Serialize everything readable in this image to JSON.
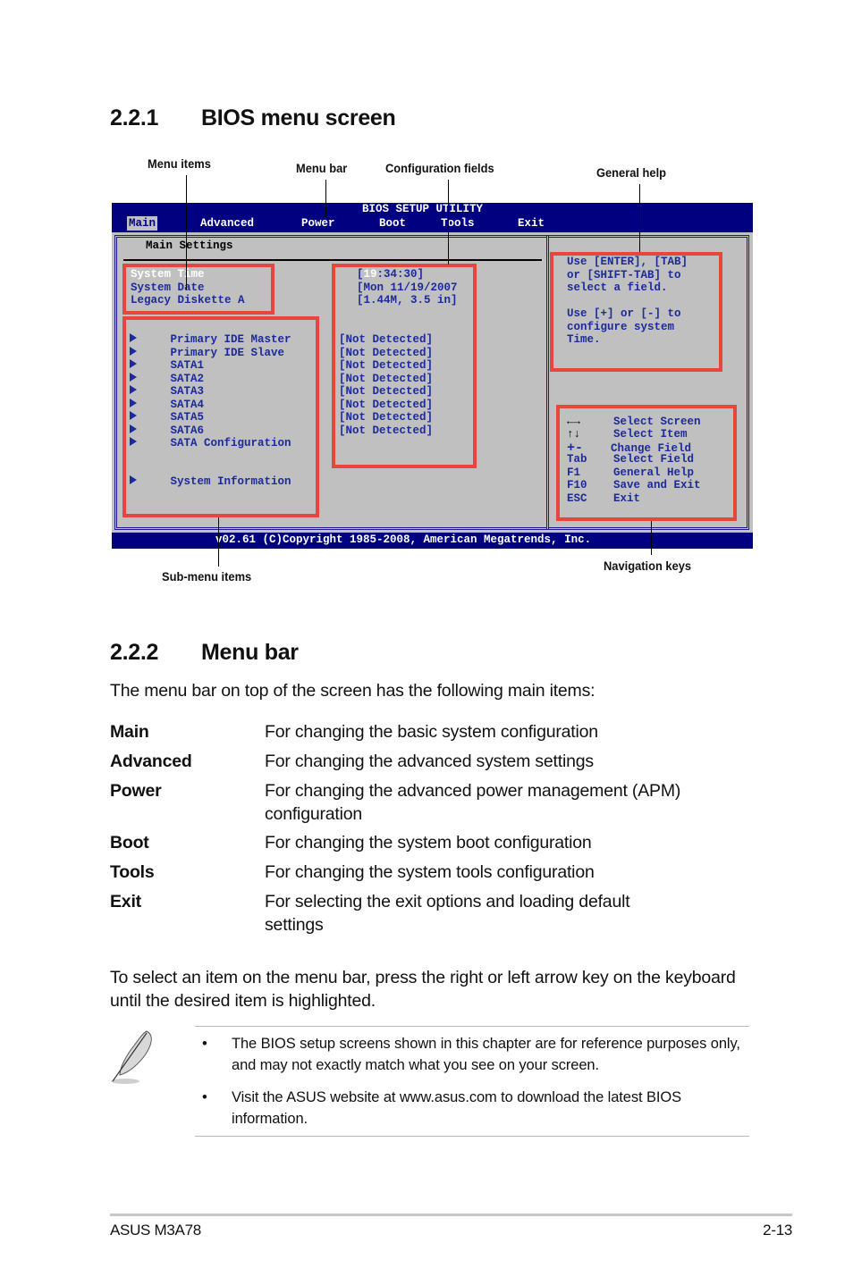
{
  "section_221": {
    "number": "2.2.1",
    "title": "BIOS menu screen"
  },
  "callouts": {
    "menu_items": "Menu items",
    "menu_bar": "Menu bar",
    "configuration_fields": "Configuration fields",
    "general_help": "General help",
    "sub_menu_items": "Sub-menu items",
    "navigation_keys": "Navigation keys"
  },
  "bios": {
    "title": "BIOS SETUP UTILITY",
    "menu": [
      "Main",
      "Advanced",
      "Power",
      "Boot",
      "Tools",
      "Exit"
    ],
    "active_menu": "Main",
    "panel_title": "Main Settings",
    "menu_items": [
      {
        "label": "System Time",
        "value": "[19:34:30]",
        "selected": true
      },
      {
        "label": "System Date",
        "value": "[Mon 11/19/2007"
      },
      {
        "label": "Legacy Diskette A",
        "value": "[1.44M, 3.5 in]"
      }
    ],
    "time_hour_highlight": "19",
    "time_rest": ":34:30]",
    "sub_menu_items": [
      {
        "label": "Primary IDE Master",
        "value": "[Not Detected]"
      },
      {
        "label": "Primary IDE Slave",
        "value": "[Not Detected]"
      },
      {
        "label": "SATA1",
        "value": "[Not Detected]"
      },
      {
        "label": "SATA2",
        "value": "[Not Detected]"
      },
      {
        "label": "SATA3",
        "value": "[Not Detected]"
      },
      {
        "label": "SATA4",
        "value": "[Not Detected]"
      },
      {
        "label": "SATA5",
        "value": "[Not Detected]"
      },
      {
        "label": "SATA6",
        "value": "[Not Detected]"
      },
      {
        "label": "SATA Configuration"
      },
      {
        "label": "System Information"
      }
    ],
    "general_help": [
      "Use [ENTER], [TAB]",
      "or [SHIFT-TAB] to",
      "select a field.",
      "",
      "Use [+] or [-] to",
      "configure system",
      "Time."
    ],
    "nav_keys": [
      {
        "key": "←→",
        "action": "Select Screen",
        "icon": "left-right-arrows-icon"
      },
      {
        "key": "↑↓",
        "action": "Select Item",
        "icon": "up-down-arrows-icon"
      },
      {
        "key": "+-",
        "action": "Change Field"
      },
      {
        "key": "Tab",
        "action": "Select Field"
      },
      {
        "key": "F1",
        "action": "General Help"
      },
      {
        "key": "F10",
        "action": "Save and Exit"
      },
      {
        "key": "ESC",
        "action": "Exit"
      }
    ],
    "footer": "v02.61 (C)Copyright 1985-2008, American Megatrends, Inc."
  },
  "section_222": {
    "number": "2.2.2",
    "title": "Menu bar"
  },
  "intro": "The menu bar on top of the screen has the following main items:",
  "menu_descriptions": [
    {
      "term": "Main",
      "desc": "For changing the basic system configuration"
    },
    {
      "term": "Advanced",
      "desc": "For changing the advanced system settings"
    },
    {
      "term": "Power",
      "desc": "For changing the advanced power management (APM) configuration"
    },
    {
      "term": "Boot",
      "desc": "For changing the system boot configuration"
    },
    {
      "term": "Tools",
      "desc": "For changing the system tools configuration"
    },
    {
      "term": "Exit",
      "desc": "For selecting the exit options and loading default settings"
    }
  ],
  "select_instruction": "To select an item on the menu bar, press the right or left arrow key on the keyboard until the desired item is highlighted.",
  "note": {
    "icon": "feather-pen-icon",
    "bullets": [
      "The BIOS setup screens shown in this chapter are for reference purposes only, and may not exactly match what you see on your screen.",
      "Visit the ASUS website at www.asus.com to download the latest BIOS information."
    ]
  },
  "footer": {
    "left": "ASUS M3A78",
    "right": "2-13"
  },
  "colors": {
    "bios_blue": "#000080",
    "bios_gray": "#c0c0c0",
    "bios_text": "#1c2a9a",
    "callout_red": "#e8453c"
  }
}
